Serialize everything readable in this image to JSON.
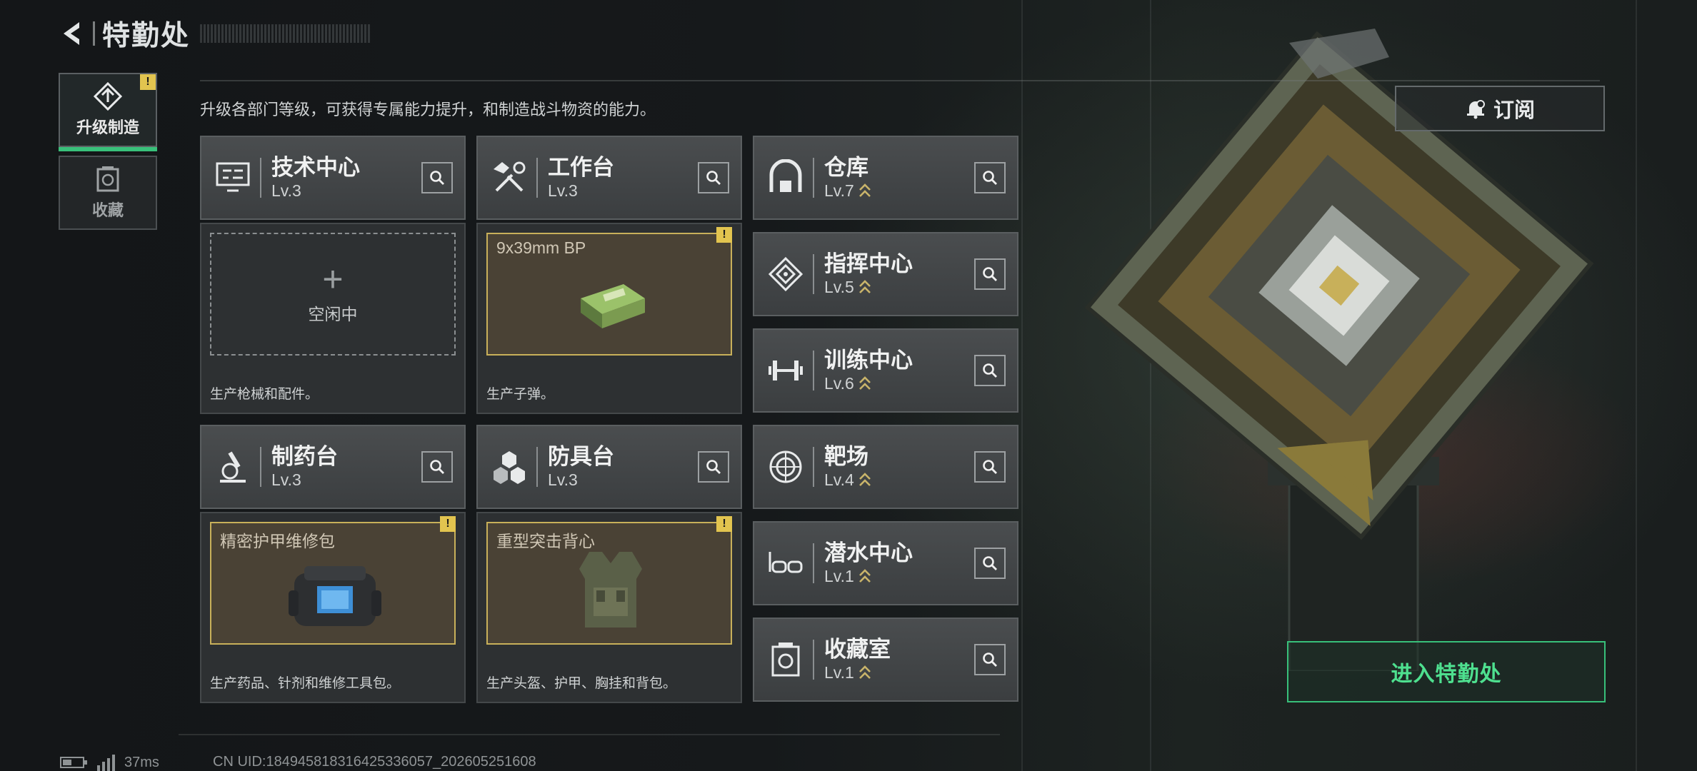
{
  "header": {
    "title": "特勤处",
    "subtitle": "升级各部门等级，可获得专属能力提升，和制造战斗物资的能力。"
  },
  "sidebar": {
    "tabs": [
      {
        "label": "升级制造",
        "active": true,
        "badge": "!"
      },
      {
        "label": "收藏",
        "active": false
      }
    ]
  },
  "subscribe_label": "订阅",
  "enter_label": "进入特勤处",
  "departments": [
    {
      "name": "技术中心",
      "level": "Lv.3",
      "icon": "tech-center-icon"
    },
    {
      "name": "工作台",
      "level": "Lv.3",
      "icon": "workbench-tools-icon"
    },
    {
      "name": "仓库",
      "level": "Lv.7",
      "icon": "warehouse-icon",
      "upgradable": true
    },
    {
      "name": "指挥中心",
      "level": "Lv.5",
      "icon": "command-center-icon",
      "upgradable": true
    },
    {
      "name": "训练中心",
      "level": "Lv.6",
      "icon": "dumbbell-icon",
      "upgradable": true
    },
    {
      "name": "制药台",
      "level": "Lv.3",
      "icon": "microscope-icon"
    },
    {
      "name": "防具台",
      "level": "Lv.3",
      "icon": "cubes-icon"
    },
    {
      "name": "靶场",
      "level": "Lv.4",
      "icon": "target-icon",
      "upgradable": true
    },
    {
      "name": "潜水中心",
      "level": "Lv.1",
      "icon": "diving-goggles-icon",
      "upgradable": true
    },
    {
      "name": "收藏室",
      "level": "Lv.1",
      "icon": "collection-room-icon",
      "upgradable": true
    }
  ],
  "production": [
    {
      "empty": true,
      "empty_label": "空闲中",
      "desc": "生产枪械和配件。"
    },
    {
      "item": "9x39mm BP",
      "desc": "生产子弹。",
      "badge": "!",
      "icon": "ammo-box-icon"
    },
    {
      "item": "精密护甲维修包",
      "desc": "生产药品、针剂和维修工具包。",
      "badge": "!",
      "icon": "repair-kit-icon"
    },
    {
      "item": "重型突击背心",
      "desc": "生产头盔、护甲、胸挂和背包。",
      "badge": "!",
      "icon": "vest-icon"
    }
  ],
  "status": {
    "ping": "37ms",
    "uid": "CN UID:1849458183164253360​57_202605251608"
  },
  "colors": {
    "accent_green": "#38c07a",
    "badge_yellow": "#e2c44f",
    "upgrade_arrow": "#c9b46a"
  }
}
